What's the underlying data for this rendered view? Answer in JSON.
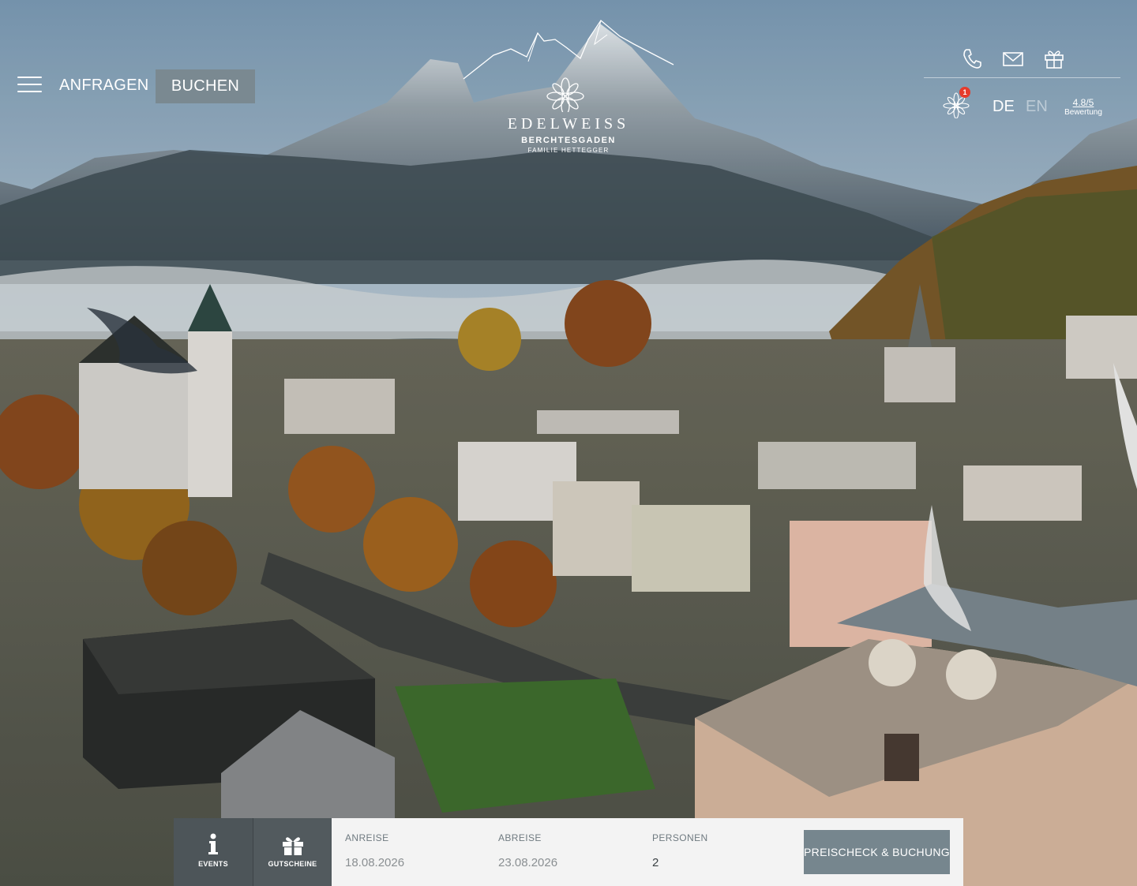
{
  "nav": {
    "menu_icon": "hamburger-icon",
    "anfragen_label": "ANFRAGEN",
    "buchen_label": "BUCHEN"
  },
  "logo": {
    "brand": "EDELWEISS",
    "place": "BERCHTESGADEN",
    "family": "FAMILIE HETTEGGER"
  },
  "header_right": {
    "icons": [
      "phone-icon",
      "mail-icon",
      "gift-icon"
    ],
    "badge_icon": "edelweiss-flower-icon",
    "badge_count": "1",
    "lang_de": "DE",
    "lang_en": "EN",
    "rating_score": "4.8/5",
    "rating_label": "Bewertung"
  },
  "booking": {
    "tiles": [
      {
        "icon": "info-icon",
        "label": "EVENTS"
      },
      {
        "icon": "gift-icon",
        "label": "GUTSCHEINE"
      }
    ],
    "arrival_label": "ANREISE",
    "arrival_value": "18.08.2026",
    "departure_label": "ABREISE",
    "departure_value": "23.08.2026",
    "persons_label": "PERSONEN",
    "persons_value": "2",
    "cta_label": "PREISCHECK & BUCHUNG"
  },
  "colors": {
    "button_gray": "#7a8991",
    "tile_dark": "#4d5559",
    "badge_red": "#e53b2c",
    "form_bg": "#f3f3f3"
  }
}
